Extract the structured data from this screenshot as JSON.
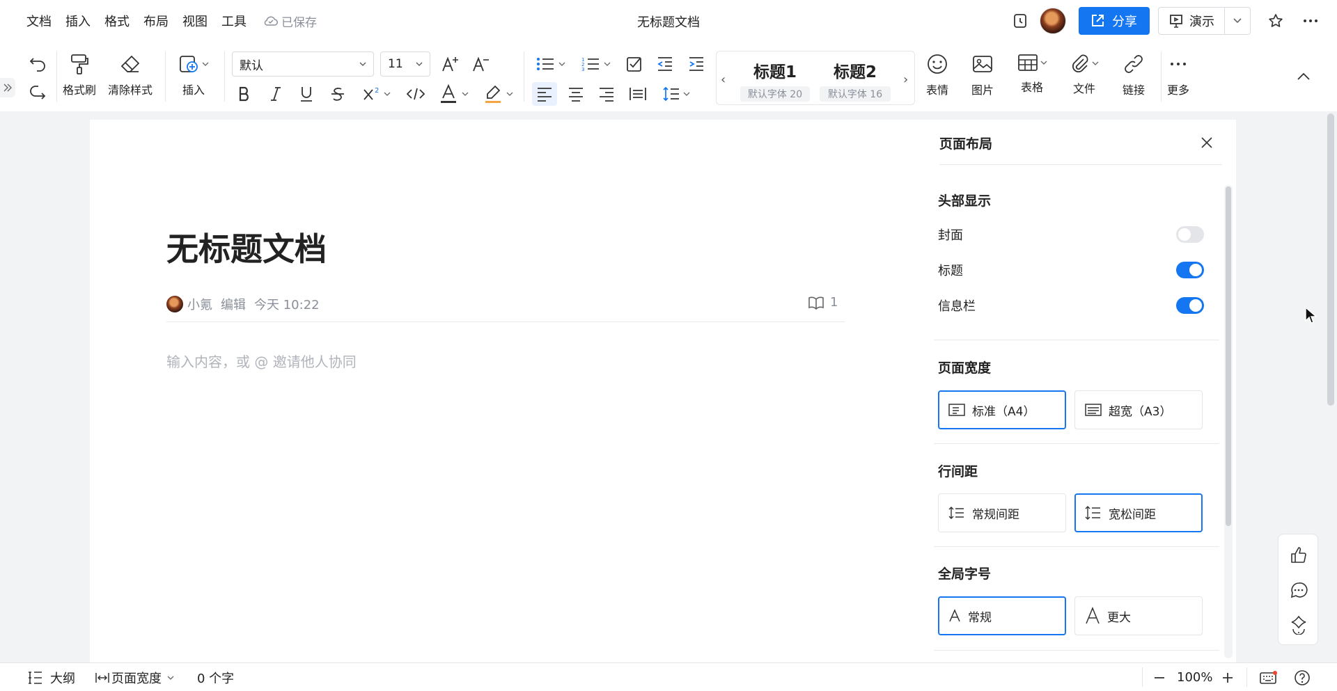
{
  "menu": [
    "文档",
    "插入",
    "格式",
    "布局",
    "视图",
    "工具"
  ],
  "saved_status": "已保存",
  "window_title": "无标题文档",
  "share_label": "分享",
  "present_label": "演示",
  "toolbar": {
    "format_painter": "格式刷",
    "clear_format": "清除样式",
    "insert": "插入",
    "font_family": "默认",
    "font_size": "11",
    "heading1_title": "标题1",
    "heading1_sub": "默认字体 20",
    "heading2_title": "标题2",
    "heading2_sub": "默认字体 16",
    "emoji": "表情",
    "image": "图片",
    "table": "表格",
    "file": "文件",
    "link": "链接",
    "more": "更多"
  },
  "doc": {
    "title": "无标题文档",
    "author": "小氪",
    "action": "编辑",
    "time": "今天 10:22",
    "reader_count": "1",
    "placeholder": "输入内容，或 @ 邀请他人协同"
  },
  "panel": {
    "title": "页面布局",
    "header_section": "头部显示",
    "cover": "封面",
    "cover_on": false,
    "title_toggle": "标题",
    "title_on": true,
    "info_bar": "信息栏",
    "info_on": true,
    "width_section": "页面宽度",
    "width_standard": "标准（A4）",
    "width_wide": "超宽（A3）",
    "spacing_section": "行间距",
    "spacing_normal": "常规间距",
    "spacing_loose": "宽松间距",
    "fontsize_section": "全局字号",
    "fontsize_normal": "常规",
    "fontsize_large": "更大"
  },
  "status": {
    "outline": "大纲",
    "page_width": "页面宽度",
    "word_count": "0 个字",
    "zoom": "100%"
  },
  "colors": {
    "accent": "#1476f0",
    "border": "#e3e5e8",
    "muted": "#8a8f99"
  }
}
